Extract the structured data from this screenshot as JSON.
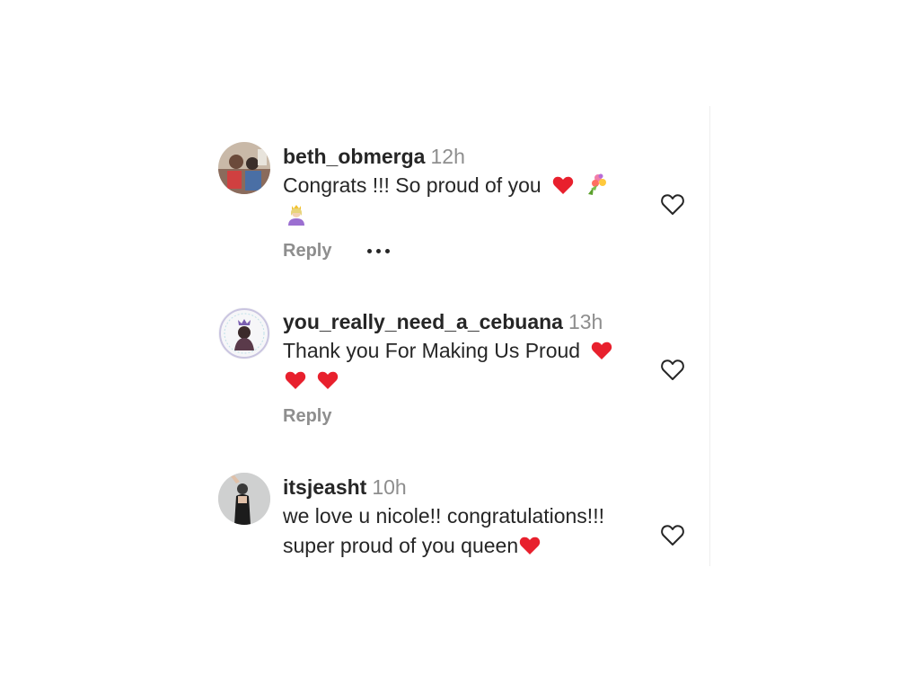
{
  "comments": [
    {
      "username": "beth_obmerga",
      "time": "12h",
      "text": "Congrats !!! So proud of you",
      "emojis": [
        "red-heart",
        "bouquet",
        "princess"
      ],
      "reply_label": "Reply",
      "has_more_menu": true
    },
    {
      "username": "you_really_need_a_cebuana",
      "time": "13h",
      "text": "Thank you For Making Us Proud",
      "emojis": [
        "red-heart",
        "red-heart",
        "red-heart"
      ],
      "reply_label": "Reply",
      "has_more_menu": false
    },
    {
      "username": "itsjeasht",
      "time": "10h",
      "text_line1": "we love u nicole!! congratulations!!!",
      "text_line2": "super proud of you queen",
      "emojis": [
        "red-heart"
      ]
    }
  ],
  "icons": {
    "like": "heart-outline-icon",
    "more": "ellipsis-icon"
  },
  "colors": {
    "username": "#262626",
    "secondary": "#8e8e8e",
    "heart": "#e8202d"
  }
}
